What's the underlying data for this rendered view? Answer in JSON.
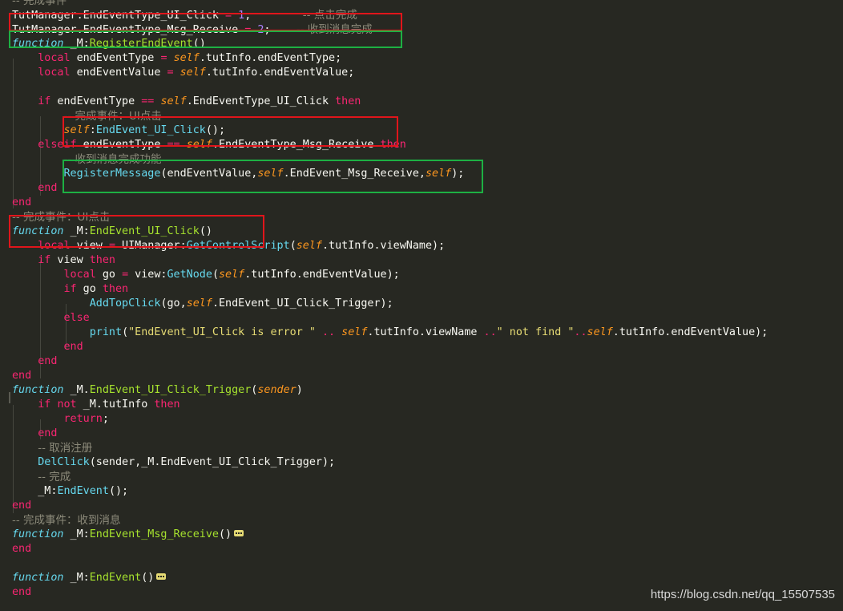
{
  "editor": {
    "lines": [
      [
        [
          "com",
          "-- 完成事件"
        ]
      ],
      [
        [
          "text",
          "TutManager.EndEventType_UI_Click "
        ],
        [
          "op",
          "="
        ],
        [
          "text",
          " "
        ],
        [
          "num",
          "1"
        ],
        [
          "text",
          ";        "
        ],
        [
          "com",
          "-- 点击完成"
        ]
      ],
      [
        [
          "text",
          "TutManager.EndEventType_Msg_Receive "
        ],
        [
          "op",
          "="
        ],
        [
          "text",
          " "
        ],
        [
          "num",
          "2"
        ],
        [
          "text",
          ";    "
        ],
        [
          "com",
          "-- 收到消息完成"
        ]
      ],
      [
        [
          "fnkw",
          "function"
        ],
        [
          "text",
          " _M:"
        ],
        [
          "fn",
          "RegisterEndEvent"
        ],
        [
          "text",
          "()"
        ]
      ],
      [
        [
          "text",
          "    "
        ],
        [
          "kw",
          "local"
        ],
        [
          "text",
          " endEventType "
        ],
        [
          "op",
          "="
        ],
        [
          "text",
          " "
        ],
        [
          "self",
          "self"
        ],
        [
          "text",
          ".tutInfo.endEventType;"
        ]
      ],
      [
        [
          "text",
          "    "
        ],
        [
          "kw",
          "local"
        ],
        [
          "text",
          " endEventValue "
        ],
        [
          "op",
          "="
        ],
        [
          "text",
          " "
        ],
        [
          "self",
          "self"
        ],
        [
          "text",
          ".tutInfo.endEventValue;"
        ]
      ],
      [],
      [
        [
          "text",
          "    "
        ],
        [
          "kw",
          "if"
        ],
        [
          "text",
          " endEventType "
        ],
        [
          "op",
          "=="
        ],
        [
          "text",
          " "
        ],
        [
          "self",
          "self"
        ],
        [
          "text",
          ".EndEventType_UI_Click "
        ],
        [
          "kw",
          "then"
        ]
      ],
      [
        [
          "text",
          "        "
        ],
        [
          "com",
          "-- 完成事件：UI点击"
        ]
      ],
      [
        [
          "text",
          "        "
        ],
        [
          "self",
          "self"
        ],
        [
          "text",
          ":"
        ],
        [
          "call",
          "EndEvent_UI_Click"
        ],
        [
          "text",
          "();"
        ]
      ],
      [
        [
          "text",
          "    "
        ],
        [
          "kw",
          "elseif"
        ],
        [
          "text",
          " endEventType "
        ],
        [
          "op",
          "=="
        ],
        [
          "text",
          " "
        ],
        [
          "self",
          "self"
        ],
        [
          "text",
          ".EndEventType_Msg_Receive "
        ],
        [
          "kw",
          "then"
        ]
      ],
      [
        [
          "text",
          "        "
        ],
        [
          "com",
          "-- 收到消息完成功能"
        ]
      ],
      [
        [
          "text",
          "        "
        ],
        [
          "call",
          "RegisterMessage"
        ],
        [
          "text",
          "(endEventValue,"
        ],
        [
          "self",
          "self"
        ],
        [
          "text",
          ".EndEvent_Msg_Receive,"
        ],
        [
          "self",
          "self"
        ],
        [
          "text",
          ");"
        ]
      ],
      [
        [
          "text",
          "    "
        ],
        [
          "kw",
          "end"
        ]
      ],
      [
        [
          "kw",
          "end"
        ]
      ],
      [
        [
          "com",
          "-- 完成事件：UI点击"
        ]
      ],
      [
        [
          "fnkw",
          "function"
        ],
        [
          "text",
          " _M:"
        ],
        [
          "fn",
          "EndEvent_UI_Click"
        ],
        [
          "text",
          "()"
        ]
      ],
      [
        [
          "text",
          "    "
        ],
        [
          "kw",
          "local"
        ],
        [
          "text",
          " view "
        ],
        [
          "op",
          "="
        ],
        [
          "text",
          " UIManager:"
        ],
        [
          "call",
          "GetControlScript"
        ],
        [
          "text",
          "("
        ],
        [
          "self",
          "self"
        ],
        [
          "text",
          ".tutInfo.viewName);"
        ]
      ],
      [
        [
          "text",
          "    "
        ],
        [
          "kw",
          "if"
        ],
        [
          "text",
          " view "
        ],
        [
          "kw",
          "then"
        ]
      ],
      [
        [
          "text",
          "        "
        ],
        [
          "kw",
          "local"
        ],
        [
          "text",
          " go "
        ],
        [
          "op",
          "="
        ],
        [
          "text",
          " view:"
        ],
        [
          "call",
          "GetNode"
        ],
        [
          "text",
          "("
        ],
        [
          "self",
          "self"
        ],
        [
          "text",
          ".tutInfo.endEventValue);"
        ]
      ],
      [
        [
          "text",
          "        "
        ],
        [
          "kw",
          "if"
        ],
        [
          "text",
          " go "
        ],
        [
          "kw",
          "then"
        ]
      ],
      [
        [
          "text",
          "            "
        ],
        [
          "call",
          "AddTopClick"
        ],
        [
          "text",
          "(go,"
        ],
        [
          "self",
          "self"
        ],
        [
          "text",
          ".EndEvent_UI_Click_Trigger);"
        ]
      ],
      [
        [
          "text",
          "        "
        ],
        [
          "kw",
          "else"
        ]
      ],
      [
        [
          "text",
          "            "
        ],
        [
          "call",
          "print"
        ],
        [
          "text",
          "("
        ],
        [
          "str",
          "\"EndEvent_UI_Click is error \""
        ],
        [
          "text",
          " "
        ],
        [
          "op",
          ".."
        ],
        [
          "text",
          " "
        ],
        [
          "self",
          "self"
        ],
        [
          "text",
          ".tutInfo.viewName "
        ],
        [
          "op",
          ".."
        ],
        [
          "str",
          "\" not find \""
        ],
        [
          "op",
          ".."
        ],
        [
          "self",
          "self"
        ],
        [
          "text",
          ".tutInfo.endEventValue);"
        ]
      ],
      [
        [
          "text",
          "        "
        ],
        [
          "kw",
          "end"
        ]
      ],
      [
        [
          "text",
          "    "
        ],
        [
          "kw",
          "end"
        ]
      ],
      [
        [
          "kw",
          "end"
        ]
      ],
      [
        [
          "fnkw",
          "function"
        ],
        [
          "text",
          " _M."
        ],
        [
          "fn",
          "EndEvent_UI_Click_Trigger"
        ],
        [
          "text",
          "("
        ],
        [
          "self",
          "sender"
        ],
        [
          "text",
          ")"
        ]
      ],
      [
        [
          "text",
          "    "
        ],
        [
          "kw",
          "if"
        ],
        [
          "text",
          " "
        ],
        [
          "kw",
          "not"
        ],
        [
          "text",
          " _M.tutInfo "
        ],
        [
          "kw",
          "then"
        ]
      ],
      [
        [
          "text",
          "        "
        ],
        [
          "kw",
          "return"
        ],
        [
          "text",
          ";"
        ]
      ],
      [
        [
          "text",
          "    "
        ],
        [
          "kw",
          "end"
        ]
      ],
      [
        [
          "text",
          "    "
        ],
        [
          "com",
          "-- 取消注册"
        ]
      ],
      [
        [
          "text",
          "    "
        ],
        [
          "call",
          "DelClick"
        ],
        [
          "text",
          "(sender,_M.EndEvent_UI_Click_Trigger);"
        ]
      ],
      [
        [
          "text",
          "    "
        ],
        [
          "com",
          "-- 完成"
        ]
      ],
      [
        [
          "text",
          "    _M:"
        ],
        [
          "call",
          "EndEvent"
        ],
        [
          "text",
          "();"
        ]
      ],
      [
        [
          "kw",
          "end"
        ]
      ],
      [
        [
          "com",
          "-- 完成事件：收到消息"
        ]
      ],
      [
        [
          "fnkw",
          "function"
        ],
        [
          "text",
          " _M:"
        ],
        [
          "fn",
          "EndEvent_Msg_Receive"
        ],
        [
          "text",
          "()"
        ],
        [
          "fold",
          "…"
        ]
      ],
      [
        [
          "kw",
          "end"
        ]
      ],
      [],
      [
        [
          "fnkw",
          "function"
        ],
        [
          "text",
          " _M:"
        ],
        [
          "fn",
          "EndEvent"
        ],
        [
          "text",
          "()"
        ],
        [
          "fold",
          "…"
        ]
      ],
      [
        [
          "kw",
          "end"
        ]
      ]
    ]
  },
  "watermark": "https://blog.csdn.net/qq_15507535",
  "colors": {
    "background": "#272822",
    "highlight_red": "#e0151b",
    "highlight_green": "#1db043"
  }
}
